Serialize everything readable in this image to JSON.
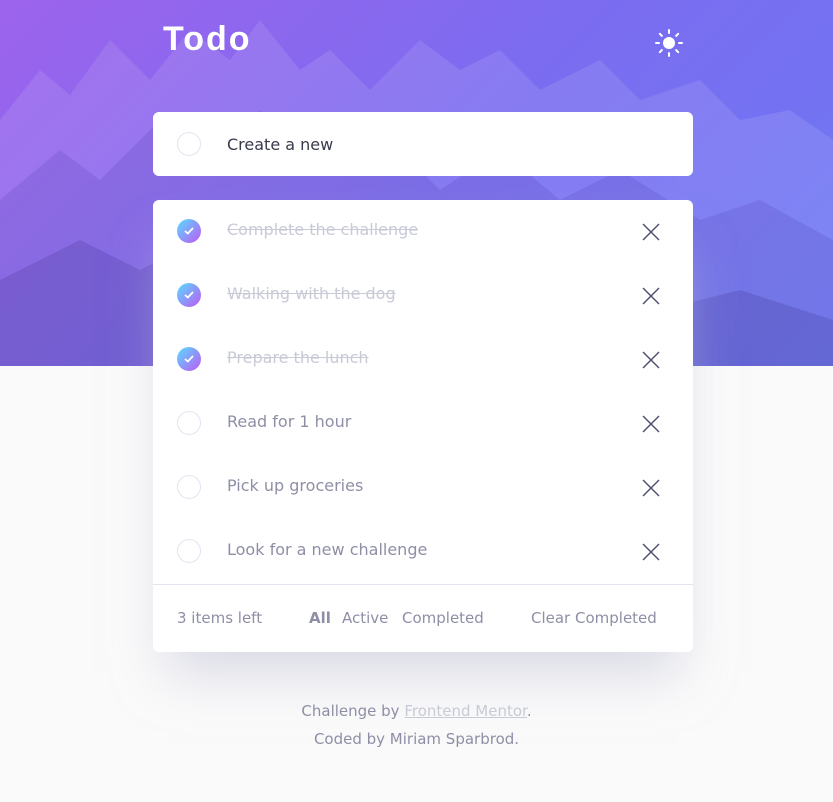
{
  "header": {
    "title": "Todo",
    "theme_icon": "sun-icon"
  },
  "create": {
    "placeholder": "Create a new"
  },
  "todos": [
    {
      "text": "Complete the challenge",
      "completed": true
    },
    {
      "text": "Walking with the dog",
      "completed": true
    },
    {
      "text": "Prepare the lunch",
      "completed": true
    },
    {
      "text": "Read for 1 hour",
      "completed": false
    },
    {
      "text": "Pick up groceries",
      "completed": false
    },
    {
      "text": "Look for a new challenge",
      "completed": false
    }
  ],
  "footer": {
    "items_left": "3 items left",
    "filters": {
      "all": "All",
      "active": "Active",
      "completed": "Completed"
    },
    "active_filter": "All",
    "clear": "Clear Completed"
  },
  "attribution": {
    "challenge_prefix": "Challenge by ",
    "link_text": "Frontend Mentor",
    "challenge_suffix": ".",
    "coded_by": "Coded by Miriam Sparbrod."
  },
  "colors": {
    "hero_gradient_start": "#9d63ec",
    "hero_gradient_end": "#6c79f4",
    "check_gradient_start": "#55ddff",
    "check_gradient_end": "#c058f3",
    "page_background": "#fafafa",
    "text_muted": "#8e8fa6",
    "text_done": "#c8cad6"
  }
}
